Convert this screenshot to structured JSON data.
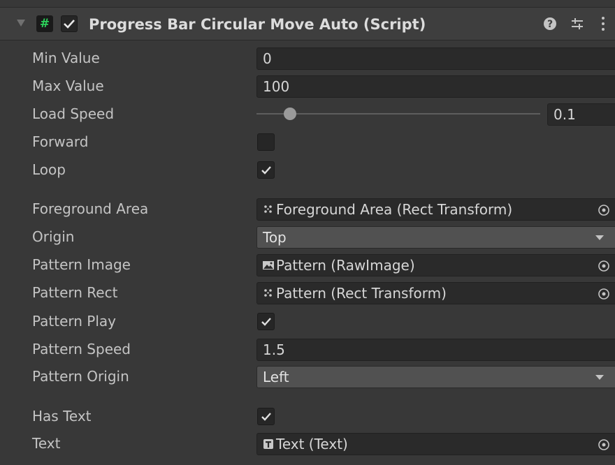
{
  "header": {
    "script_icon": "#",
    "title": "Progress Bar Circular Move Auto (Script)",
    "enabled": true,
    "icons": [
      "foldout-arrow-icon",
      "script-icon",
      "help-icon",
      "presets-icon",
      "more-icon"
    ]
  },
  "fields": {
    "min_value": {
      "label": "Min Value",
      "value": "0"
    },
    "max_value": {
      "label": "Max Value",
      "value": "100"
    },
    "load_speed": {
      "label": "Load Speed",
      "value": "0.1",
      "slider_fraction": 0.1
    },
    "forward": {
      "label": "Forward",
      "checked": false
    },
    "loop": {
      "label": "Loop",
      "checked": true
    },
    "foreground_area": {
      "label": "Foreground Area",
      "value": "Foreground Area (Rect Transform)",
      "icon": "rect-transform-icon"
    },
    "origin": {
      "label": "Origin",
      "value": "Top"
    },
    "pattern_image": {
      "label": "Pattern Image",
      "value": "Pattern (RawImage)",
      "icon": "raw-image-icon"
    },
    "pattern_rect": {
      "label": "Pattern Rect",
      "value": "Pattern (Rect Transform)",
      "icon": "rect-transform-icon"
    },
    "pattern_play": {
      "label": "Pattern Play",
      "checked": true
    },
    "pattern_speed": {
      "label": "Pattern Speed",
      "value": "1.5"
    },
    "pattern_origin": {
      "label": "Pattern Origin",
      "value": "Left"
    },
    "has_text": {
      "label": "Has Text",
      "checked": true
    },
    "text": {
      "label": "Text",
      "value": "Text (Text)",
      "icon": "text-component-icon"
    }
  },
  "colors": {
    "background": "#383838",
    "header": "#3e3e3e",
    "field": "#2a2a2a",
    "dropdown": "#515151",
    "script_icon_hash": "#2cd35a",
    "text": "#c4c4c4"
  }
}
